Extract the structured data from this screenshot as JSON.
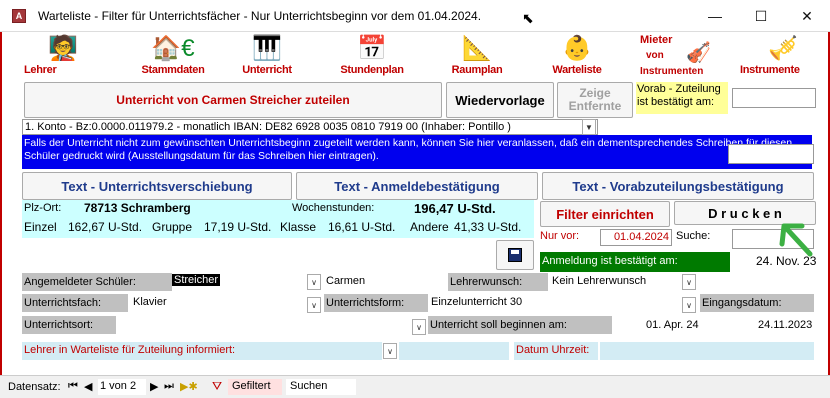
{
  "window": {
    "title": "Warteliste - Filter für Unterrichtsfächer - Nur Unterrichtsbeginn vor dem 01.04.2024.",
    "minimize": "—",
    "maximize": "☐",
    "close": "✕"
  },
  "nav": [
    {
      "label": "Lehrer",
      "icon": "🧑‍🏫"
    },
    {
      "label": "Stammdaten",
      "icon": "🏠€"
    },
    {
      "label": "Unterricht",
      "icon": "🎹"
    },
    {
      "label": "Stundenplan",
      "icon": "📅"
    },
    {
      "label": "Raumplan",
      "icon": "📐"
    },
    {
      "label": "Warteliste",
      "icon": "👶"
    },
    {
      "label": "Mieter von Instrumenten",
      "icon": "🎻"
    },
    {
      "label": "Instrumente",
      "icon": "🎺"
    }
  ],
  "nav_mieter": {
    "line1": "Mieter",
    "line2": "von",
    "line3": "Instrumenten"
  },
  "buttons": {
    "zuteilen": "Unterricht von Carmen Streicher zuteilen",
    "wiedervorlage": "Wiedervorlage",
    "zeige_entfernte": "Zeige Entfernte",
    "verschiebung": "Text - Unterrichtsverschiebung",
    "anmeldebestaetigung": "Text - Anmeldebestätigung",
    "vorabzuteilung": "Text - Vorabzuteilungsbestätigung",
    "filter": "Filter einrichten",
    "drucken": "D r u c k e n"
  },
  "vorab": {
    "label": "Vorab - Zuteilung ist bestätigt am:",
    "value": ""
  },
  "konto": "1. Konto - Bz:0.0000.011979.2 - monatlich IBAN: DE82 6928 0035 0810 7919 00 (Inhaber: Pontillo )",
  "info": "Falls der Unterricht nicht zum gewünschten Unterrichtsbeginn zugeteilt werden kann, können Sie hier veranlassen, daß ein dementsprechendes Schreiben für diesen Schüler gedruckt wird (Ausstellungsdatum für das Schreiben hier eintragen).",
  "summary": {
    "plz_label": "Plz-Ort:",
    "plz_value": "78713 Schramberg",
    "wochen_label": "Wochenstunden:",
    "wochen_value": "196,47 U-Std.",
    "einzel_label": "Einzel",
    "einzel_value": "162,67 U-Std.",
    "gruppe_label": "Gruppe",
    "gruppe_value": "17,19 U-Std.",
    "klasse_label": "Klasse",
    "klasse_value": "16,61 U-Std.",
    "andere_label": "Andere",
    "andere_value": "41,33 U-Std."
  },
  "nurvor": {
    "label": "Nur vor:",
    "value": "01.04.2024"
  },
  "suche": {
    "label": "Suche:",
    "value": ""
  },
  "anmeldung": {
    "label": "Anmeldung ist bestätigt am:",
    "value": "24. Nov. 23"
  },
  "form": {
    "schueler_label": "Angemeldeter Schüler:",
    "schueler_last": "Streicher",
    "schueler_first": "Carmen",
    "lehrerwunsch_label": "Lehrerwunsch:",
    "lehrerwunsch_value": "Kein Lehrerwunsch",
    "fach_label": "Unterrichtsfach:",
    "fach_value": "Klavier",
    "form_label": "Unterrichtsform:",
    "form_value": "Einzelunterricht 30",
    "eingang_label": "Eingangsdatum:",
    "eingang_value": "24.11.2023",
    "ort_label": "Unterrichtsort:",
    "beginn_label": "Unterricht soll beginnen am:",
    "beginn_value": "01. Apr. 24",
    "lehrer_info_label": "Lehrer in Warteliste für Zuteilung informiert:",
    "datum_label": "Datum Uhrzeit:"
  },
  "status": {
    "record_label": "Datensatz:",
    "record_value": "1 von 2",
    "filter": "Gefiltert",
    "search": "Suchen"
  }
}
